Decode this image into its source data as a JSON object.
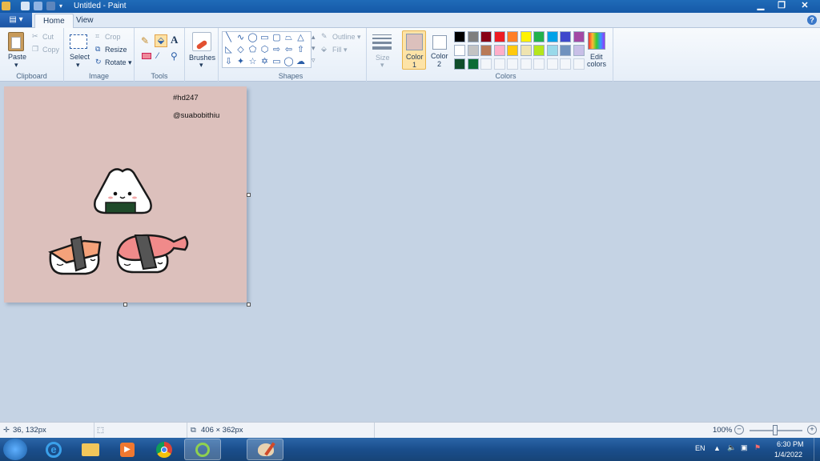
{
  "window": {
    "title": "Untitled - Paint"
  },
  "tabs": {
    "file": "▤ ▾",
    "home": "Home",
    "view": "View"
  },
  "ribbon": {
    "clipboard": {
      "group": "Clipboard",
      "paste": "Paste",
      "cut": "Cut",
      "copy": "Copy"
    },
    "image": {
      "group": "Image",
      "select": "Select",
      "crop": "Crop",
      "resize": "Resize",
      "rotate": "Rotate ▾"
    },
    "tools": {
      "group": "Tools"
    },
    "brushes": {
      "label": "Brushes"
    },
    "shapes": {
      "group": "Shapes",
      "outline": "Outline ▾",
      "fill": "Fill ▾"
    },
    "size": {
      "label": "Size"
    },
    "colors": {
      "group": "Colors",
      "color1_line1": "Color",
      "color1_line2": "1",
      "color2_line1": "Color",
      "color2_line2": "2",
      "edit_line1": "Edit",
      "edit_line2": "colors",
      "color1_value": "#dcc0bc",
      "color2_value": "#ffffff",
      "row1": [
        "#000000",
        "#7f7f7f",
        "#880015",
        "#ed1c24",
        "#ff7f27",
        "#fff200",
        "#22b14c",
        "#00a2e8",
        "#3f48cc",
        "#a349a4"
      ],
      "row2": [
        "#ffffff",
        "#c3c3c3",
        "#b97a57",
        "#ffaec9",
        "#ffc90e",
        "#efe4b0",
        "#b5e61d",
        "#99d9ea",
        "#7092be",
        "#c8bfe7"
      ],
      "row3": [
        "#0f4d2b",
        "#0b6b35",
        "",
        "",
        "",
        "",
        "",
        "",
        "",
        ""
      ]
    }
  },
  "canvas": {
    "background": "#dcc0bc",
    "text1": "#hd247",
    "text2": "@suabobithiu"
  },
  "status": {
    "cursor": "36, 132px",
    "size": "406 × 362px",
    "zoom": "100%"
  },
  "taskbar": {
    "lang": "EN",
    "time": "6:30 PM",
    "date": "1/4/2022"
  }
}
